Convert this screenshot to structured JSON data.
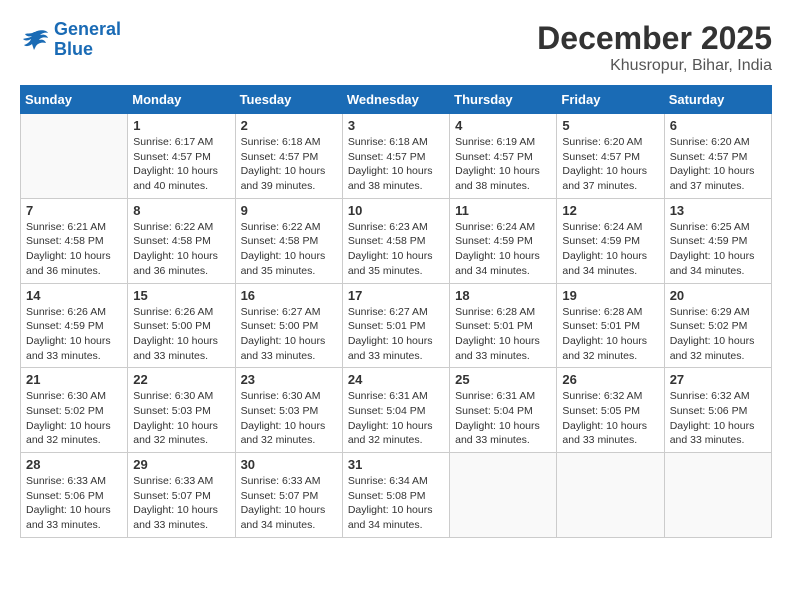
{
  "logo": {
    "text_general": "General",
    "text_blue": "Blue"
  },
  "title": {
    "month_year": "December 2025",
    "location": "Khusropur, Bihar, India"
  },
  "weekdays": [
    "Sunday",
    "Monday",
    "Tuesday",
    "Wednesday",
    "Thursday",
    "Friday",
    "Saturday"
  ],
  "weeks": [
    [
      {
        "day": "",
        "sunrise": "",
        "sunset": "",
        "daylight": ""
      },
      {
        "day": "1",
        "sunrise": "Sunrise: 6:17 AM",
        "sunset": "Sunset: 4:57 PM",
        "daylight": "Daylight: 10 hours and 40 minutes."
      },
      {
        "day": "2",
        "sunrise": "Sunrise: 6:18 AM",
        "sunset": "Sunset: 4:57 PM",
        "daylight": "Daylight: 10 hours and 39 minutes."
      },
      {
        "day": "3",
        "sunrise": "Sunrise: 6:18 AM",
        "sunset": "Sunset: 4:57 PM",
        "daylight": "Daylight: 10 hours and 38 minutes."
      },
      {
        "day": "4",
        "sunrise": "Sunrise: 6:19 AM",
        "sunset": "Sunset: 4:57 PM",
        "daylight": "Daylight: 10 hours and 38 minutes."
      },
      {
        "day": "5",
        "sunrise": "Sunrise: 6:20 AM",
        "sunset": "Sunset: 4:57 PM",
        "daylight": "Daylight: 10 hours and 37 minutes."
      },
      {
        "day": "6",
        "sunrise": "Sunrise: 6:20 AM",
        "sunset": "Sunset: 4:57 PM",
        "daylight": "Daylight: 10 hours and 37 minutes."
      }
    ],
    [
      {
        "day": "7",
        "sunrise": "Sunrise: 6:21 AM",
        "sunset": "Sunset: 4:58 PM",
        "daylight": "Daylight: 10 hours and 36 minutes."
      },
      {
        "day": "8",
        "sunrise": "Sunrise: 6:22 AM",
        "sunset": "Sunset: 4:58 PM",
        "daylight": "Daylight: 10 hours and 36 minutes."
      },
      {
        "day": "9",
        "sunrise": "Sunrise: 6:22 AM",
        "sunset": "Sunset: 4:58 PM",
        "daylight": "Daylight: 10 hours and 35 minutes."
      },
      {
        "day": "10",
        "sunrise": "Sunrise: 6:23 AM",
        "sunset": "Sunset: 4:58 PM",
        "daylight": "Daylight: 10 hours and 35 minutes."
      },
      {
        "day": "11",
        "sunrise": "Sunrise: 6:24 AM",
        "sunset": "Sunset: 4:59 PM",
        "daylight": "Daylight: 10 hours and 34 minutes."
      },
      {
        "day": "12",
        "sunrise": "Sunrise: 6:24 AM",
        "sunset": "Sunset: 4:59 PM",
        "daylight": "Daylight: 10 hours and 34 minutes."
      },
      {
        "day": "13",
        "sunrise": "Sunrise: 6:25 AM",
        "sunset": "Sunset: 4:59 PM",
        "daylight": "Daylight: 10 hours and 34 minutes."
      }
    ],
    [
      {
        "day": "14",
        "sunrise": "Sunrise: 6:26 AM",
        "sunset": "Sunset: 4:59 PM",
        "daylight": "Daylight: 10 hours and 33 minutes."
      },
      {
        "day": "15",
        "sunrise": "Sunrise: 6:26 AM",
        "sunset": "Sunset: 5:00 PM",
        "daylight": "Daylight: 10 hours and 33 minutes."
      },
      {
        "day": "16",
        "sunrise": "Sunrise: 6:27 AM",
        "sunset": "Sunset: 5:00 PM",
        "daylight": "Daylight: 10 hours and 33 minutes."
      },
      {
        "day": "17",
        "sunrise": "Sunrise: 6:27 AM",
        "sunset": "Sunset: 5:01 PM",
        "daylight": "Daylight: 10 hours and 33 minutes."
      },
      {
        "day": "18",
        "sunrise": "Sunrise: 6:28 AM",
        "sunset": "Sunset: 5:01 PM",
        "daylight": "Daylight: 10 hours and 33 minutes."
      },
      {
        "day": "19",
        "sunrise": "Sunrise: 6:28 AM",
        "sunset": "Sunset: 5:01 PM",
        "daylight": "Daylight: 10 hours and 32 minutes."
      },
      {
        "day": "20",
        "sunrise": "Sunrise: 6:29 AM",
        "sunset": "Sunset: 5:02 PM",
        "daylight": "Daylight: 10 hours and 32 minutes."
      }
    ],
    [
      {
        "day": "21",
        "sunrise": "Sunrise: 6:30 AM",
        "sunset": "Sunset: 5:02 PM",
        "daylight": "Daylight: 10 hours and 32 minutes."
      },
      {
        "day": "22",
        "sunrise": "Sunrise: 6:30 AM",
        "sunset": "Sunset: 5:03 PM",
        "daylight": "Daylight: 10 hours and 32 minutes."
      },
      {
        "day": "23",
        "sunrise": "Sunrise: 6:30 AM",
        "sunset": "Sunset: 5:03 PM",
        "daylight": "Daylight: 10 hours and 32 minutes."
      },
      {
        "day": "24",
        "sunrise": "Sunrise: 6:31 AM",
        "sunset": "Sunset: 5:04 PM",
        "daylight": "Daylight: 10 hours and 32 minutes."
      },
      {
        "day": "25",
        "sunrise": "Sunrise: 6:31 AM",
        "sunset": "Sunset: 5:04 PM",
        "daylight": "Daylight: 10 hours and 33 minutes."
      },
      {
        "day": "26",
        "sunrise": "Sunrise: 6:32 AM",
        "sunset": "Sunset: 5:05 PM",
        "daylight": "Daylight: 10 hours and 33 minutes."
      },
      {
        "day": "27",
        "sunrise": "Sunrise: 6:32 AM",
        "sunset": "Sunset: 5:06 PM",
        "daylight": "Daylight: 10 hours and 33 minutes."
      }
    ],
    [
      {
        "day": "28",
        "sunrise": "Sunrise: 6:33 AM",
        "sunset": "Sunset: 5:06 PM",
        "daylight": "Daylight: 10 hours and 33 minutes."
      },
      {
        "day": "29",
        "sunrise": "Sunrise: 6:33 AM",
        "sunset": "Sunset: 5:07 PM",
        "daylight": "Daylight: 10 hours and 33 minutes."
      },
      {
        "day": "30",
        "sunrise": "Sunrise: 6:33 AM",
        "sunset": "Sunset: 5:07 PM",
        "daylight": "Daylight: 10 hours and 34 minutes."
      },
      {
        "day": "31",
        "sunrise": "Sunrise: 6:34 AM",
        "sunset": "Sunset: 5:08 PM",
        "daylight": "Daylight: 10 hours and 34 minutes."
      },
      {
        "day": "",
        "sunrise": "",
        "sunset": "",
        "daylight": ""
      },
      {
        "day": "",
        "sunrise": "",
        "sunset": "",
        "daylight": ""
      },
      {
        "day": "",
        "sunrise": "",
        "sunset": "",
        "daylight": ""
      }
    ]
  ]
}
